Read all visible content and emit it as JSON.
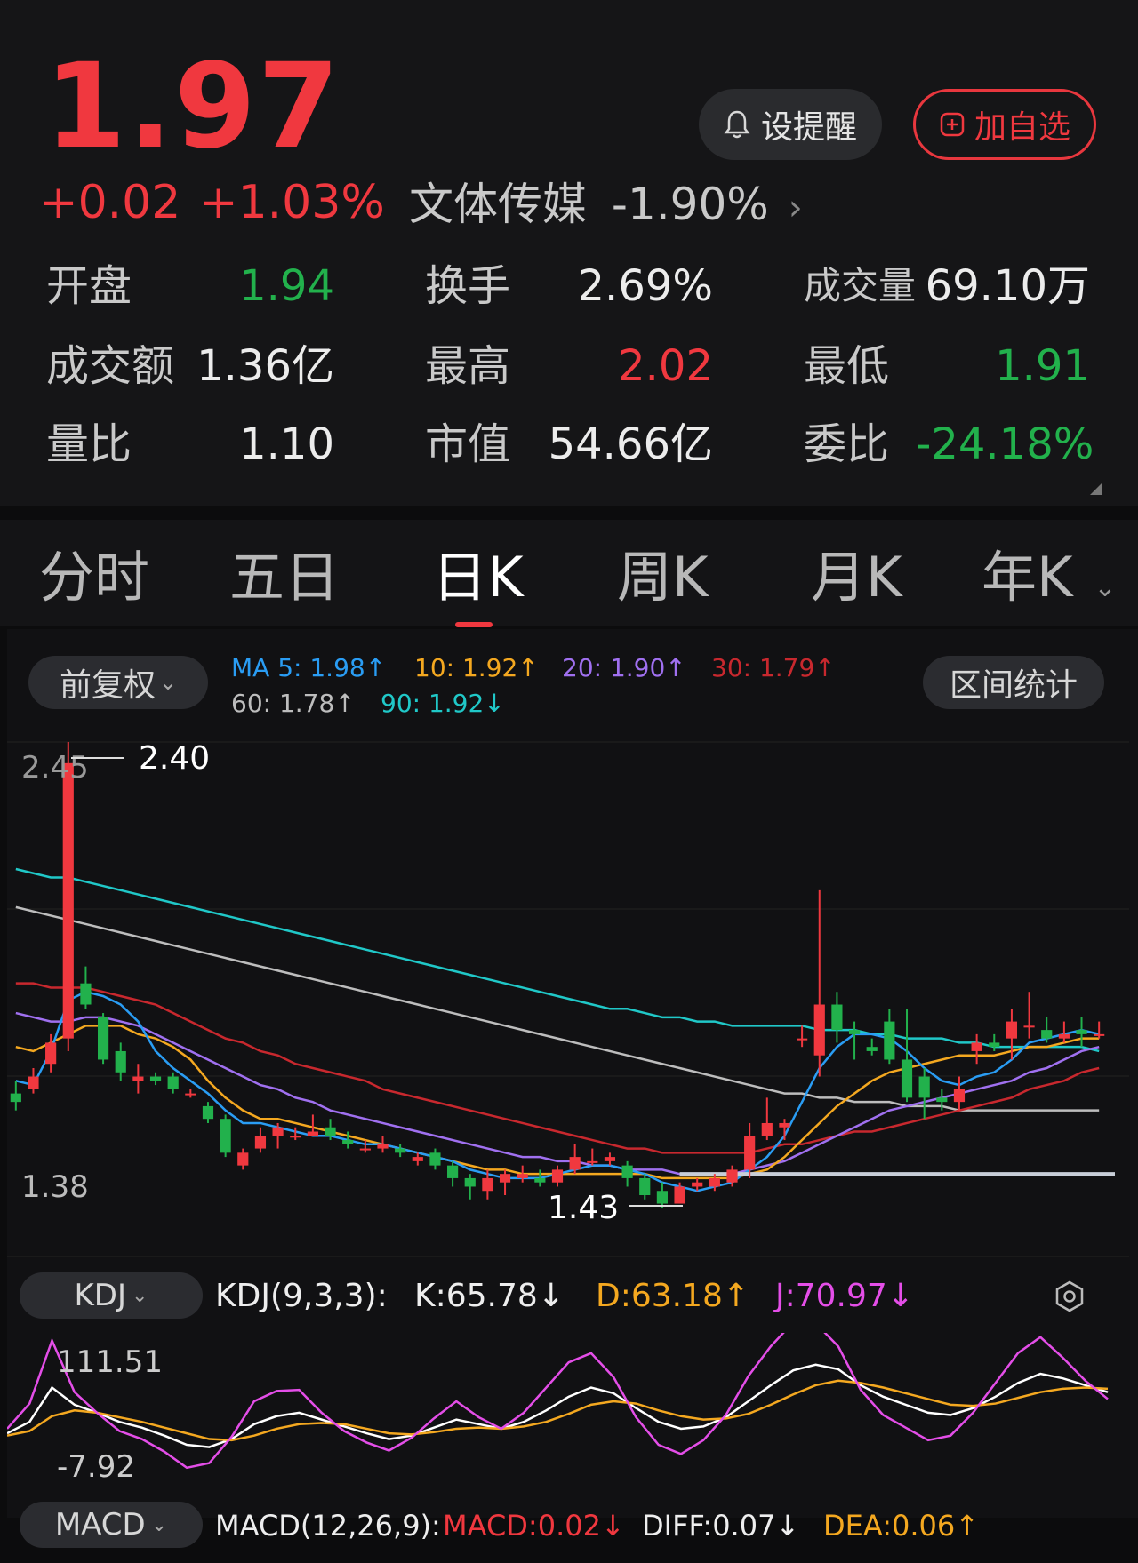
{
  "quote": {
    "price": "1.97",
    "change": "+0.02",
    "change_pct": "+1.03%",
    "sector_name": "文体传媒",
    "sector_change": "-1.90%",
    "sector_arrow": "›"
  },
  "actions": {
    "alert_label": "设提醒",
    "watch_label": "加自选"
  },
  "stats": {
    "open_label": "开盘",
    "open_value": "1.94",
    "turnover_label": "换手",
    "turnover_value": "2.69%",
    "volume_label": "成交量",
    "volume_value": "69.10万",
    "amount_label": "成交额",
    "amount_value": "1.36亿",
    "high_label": "最高",
    "high_value": "2.02",
    "low_label": "最低",
    "low_value": "1.91",
    "vol_ratio_label": "量比",
    "vol_ratio_value": "1.10",
    "mktcap_label": "市值",
    "mktcap_value": "54.66亿",
    "order_ratio_label": "委比",
    "order_ratio_value": "-24.18%"
  },
  "tabs": [
    "分时",
    "五日",
    "日K",
    "周K",
    "月K",
    "年K"
  ],
  "active_tab": "日K",
  "chart_controls": {
    "adjust_label": "前复权",
    "range_stats_label": "区间统计"
  },
  "ma_legend": {
    "ma5": "MA 5: 1.98↑",
    "ma10": "10: 1.92↑",
    "ma20": "20: 1.90↑",
    "ma30": "30: 1.79↑",
    "ma60": "60: 1.78↑",
    "ma90": "90: 1.92↓"
  },
  "colors": {
    "up": "#f0383f",
    "down": "#22b14c",
    "ma5": "#2a9df4",
    "ma10": "#f4a820",
    "ma20": "#a070f0",
    "ma30": "#c8282e",
    "ma60": "#bdbdbd",
    "ma90": "#20c8c8"
  },
  "kline_labels": {
    "axis_top": "2.45",
    "axis_bottom": "1.38",
    "marker_high": "2.40",
    "marker_low": "1.43"
  },
  "kdj": {
    "selector": "KDJ",
    "params": "KDJ(9,3,3):",
    "k": "K:65.78↓",
    "d": "D:63.18↑",
    "j": "J:70.97↓",
    "axis_top": "111.51",
    "axis_bottom": "-7.92"
  },
  "macd": {
    "selector": "MACD",
    "params": "MACD(12,26,9):",
    "macd": "MACD:0.02↓",
    "diff": "DIFF:0.07↓",
    "dea": "DEA:0.06↑"
  },
  "chart_data": [
    {
      "type": "candlestick",
      "ylim": [
        1.38,
        2.45
      ],
      "candles": [
        {
          "o": 1.62,
          "c": 1.6,
          "h": 1.65,
          "l": 1.58
        },
        {
          "o": 1.63,
          "c": 1.66,
          "h": 1.68,
          "l": 1.62
        },
        {
          "o": 1.69,
          "c": 1.74,
          "h": 1.76,
          "l": 1.67
        },
        {
          "o": 1.75,
          "c": 2.4,
          "h": 2.45,
          "l": 1.72
        },
        {
          "o": 1.88,
          "c": 1.83,
          "h": 1.92,
          "l": 1.82
        },
        {
          "o": 1.8,
          "c": 1.7,
          "h": 1.81,
          "l": 1.69
        },
        {
          "o": 1.72,
          "c": 1.67,
          "h": 1.74,
          "l": 1.65
        },
        {
          "o": 1.65,
          "c": 1.66,
          "h": 1.69,
          "l": 1.62
        },
        {
          "o": 1.66,
          "c": 1.65,
          "h": 1.67,
          "l": 1.64
        },
        {
          "o": 1.66,
          "c": 1.63,
          "h": 1.67,
          "l": 1.62
        },
        {
          "o": 1.62,
          "c": 1.62,
          "h": 1.63,
          "l": 1.61
        },
        {
          "o": 1.59,
          "c": 1.56,
          "h": 1.6,
          "l": 1.55
        },
        {
          "o": 1.56,
          "c": 1.48,
          "h": 1.57,
          "l": 1.47
        },
        {
          "o": 1.45,
          "c": 1.48,
          "h": 1.49,
          "l": 1.44
        },
        {
          "o": 1.49,
          "c": 1.52,
          "h": 1.54,
          "l": 1.48
        },
        {
          "o": 1.52,
          "c": 1.54,
          "h": 1.55,
          "l": 1.49
        },
        {
          "o": 1.52,
          "c": 1.52,
          "h": 1.54,
          "l": 1.51
        },
        {
          "o": 1.52,
          "c": 1.53,
          "h": 1.57,
          "l": 1.52
        },
        {
          "o": 1.54,
          "c": 1.52,
          "h": 1.56,
          "l": 1.51
        },
        {
          "o": 1.51,
          "c": 1.5,
          "h": 1.53,
          "l": 1.49
        },
        {
          "o": 1.49,
          "c": 1.49,
          "h": 1.51,
          "l": 1.48
        },
        {
          "o": 1.49,
          "c": 1.5,
          "h": 1.52,
          "l": 1.48
        },
        {
          "o": 1.49,
          "c": 1.48,
          "h": 1.5,
          "l": 1.47
        },
        {
          "o": 1.46,
          "c": 1.47,
          "h": 1.48,
          "l": 1.45
        },
        {
          "o": 1.48,
          "c": 1.45,
          "h": 1.49,
          "l": 1.44
        },
        {
          "o": 1.45,
          "c": 1.42,
          "h": 1.46,
          "l": 1.4
        },
        {
          "o": 1.42,
          "c": 1.4,
          "h": 1.43,
          "l": 1.37
        },
        {
          "o": 1.39,
          "c": 1.42,
          "h": 1.44,
          "l": 1.37
        },
        {
          "o": 1.41,
          "c": 1.43,
          "h": 1.44,
          "l": 1.38
        },
        {
          "o": 1.42,
          "c": 1.43,
          "h": 1.45,
          "l": 1.41
        },
        {
          "o": 1.42,
          "c": 1.41,
          "h": 1.44,
          "l": 1.4
        },
        {
          "o": 1.41,
          "c": 1.44,
          "h": 1.45,
          "l": 1.4
        },
        {
          "o": 1.44,
          "c": 1.47,
          "h": 1.5,
          "l": 1.43
        },
        {
          "o": 1.46,
          "c": 1.46,
          "h": 1.49,
          "l": 1.45
        },
        {
          "o": 1.46,
          "c": 1.47,
          "h": 1.48,
          "l": 1.45
        },
        {
          "o": 1.45,
          "c": 1.42,
          "h": 1.46,
          "l": 1.4
        },
        {
          "o": 1.42,
          "c": 1.38,
          "h": 1.43,
          "l": 1.37
        },
        {
          "o": 1.39,
          "c": 1.36,
          "h": 1.41,
          "l": 1.35
        },
        {
          "o": 1.36,
          "c": 1.4,
          "h": 1.41,
          "l": 1.36
        },
        {
          "o": 1.4,
          "c": 1.41,
          "h": 1.42,
          "l": 1.39
        },
        {
          "o": 1.4,
          "c": 1.42,
          "h": 1.43,
          "l": 1.39
        },
        {
          "o": 1.41,
          "c": 1.44,
          "h": 1.45,
          "l": 1.4
        },
        {
          "o": 1.44,
          "c": 1.52,
          "h": 1.55,
          "l": 1.42
        },
        {
          "o": 1.52,
          "c": 1.55,
          "h": 1.61,
          "l": 1.51
        },
        {
          "o": 1.54,
          "c": 1.55,
          "h": 1.56,
          "l": 1.51
        },
        {
          "o": 1.75,
          "c": 1.75,
          "h": 1.78,
          "l": 1.73
        },
        {
          "o": 1.71,
          "c": 1.83,
          "h": 2.1,
          "l": 1.66
        },
        {
          "o": 1.83,
          "c": 1.77,
          "h": 1.86,
          "l": 1.74
        },
        {
          "o": 1.77,
          "c": 1.76,
          "h": 1.79,
          "l": 1.7
        },
        {
          "o": 1.73,
          "c": 1.72,
          "h": 1.75,
          "l": 1.71
        },
        {
          "o": 1.79,
          "c": 1.7,
          "h": 1.82,
          "l": 1.69
        },
        {
          "o": 1.7,
          "c": 1.61,
          "h": 1.82,
          "l": 1.6
        },
        {
          "o": 1.66,
          "c": 1.61,
          "h": 1.68,
          "l": 1.56
        },
        {
          "o": 1.61,
          "c": 1.6,
          "h": 1.63,
          "l": 1.58
        },
        {
          "o": 1.6,
          "c": 1.63,
          "h": 1.66,
          "l": 1.58
        },
        {
          "o": 1.72,
          "c": 1.74,
          "h": 1.76,
          "l": 1.69
        },
        {
          "o": 1.74,
          "c": 1.73,
          "h": 1.76,
          "l": 1.72
        },
        {
          "o": 1.75,
          "c": 1.79,
          "h": 1.82,
          "l": 1.7
        },
        {
          "o": 1.78,
          "c": 1.78,
          "h": 1.86,
          "l": 1.75
        },
        {
          "o": 1.77,
          "c": 1.75,
          "h": 1.8,
          "l": 1.74
        },
        {
          "o": 1.75,
          "c": 1.76,
          "h": 1.79,
          "l": 1.74
        },
        {
          "o": 1.77,
          "c": 1.76,
          "h": 1.8,
          "l": 1.73
        },
        {
          "o": 1.76,
          "c": 1.76,
          "h": 1.79,
          "l": 1.75
        }
      ],
      "lines": {
        "ma5": [
          1.65,
          1.64,
          1.72,
          1.84,
          1.86,
          1.85,
          1.83,
          1.79,
          1.72,
          1.68,
          1.65,
          1.62,
          1.58,
          1.55,
          1.55,
          1.54,
          1.53,
          1.52,
          1.52,
          1.51,
          1.5,
          1.5,
          1.49,
          1.48,
          1.47,
          1.46,
          1.44,
          1.43,
          1.42,
          1.42,
          1.42,
          1.43,
          1.44,
          1.45,
          1.45,
          1.44,
          1.43,
          1.41,
          1.4,
          1.39,
          1.4,
          1.41,
          1.44,
          1.47,
          1.52,
          1.6,
          1.68,
          1.73,
          1.76,
          1.76,
          1.75,
          1.72,
          1.68,
          1.65,
          1.64,
          1.66,
          1.67,
          1.7,
          1.74,
          1.75,
          1.76,
          1.77,
          1.76
        ],
        "ma10": [
          1.73,
          1.72,
          1.74,
          1.76,
          1.78,
          1.78,
          1.78,
          1.76,
          1.75,
          1.73,
          1.7,
          1.65,
          1.61,
          1.58,
          1.56,
          1.56,
          1.55,
          1.54,
          1.53,
          1.52,
          1.51,
          1.5,
          1.49,
          1.48,
          1.47,
          1.46,
          1.45,
          1.44,
          1.44,
          1.43,
          1.43,
          1.43,
          1.43,
          1.43,
          1.43,
          1.43,
          1.43,
          1.42,
          1.42,
          1.42,
          1.42,
          1.42,
          1.43,
          1.44,
          1.47,
          1.51,
          1.55,
          1.59,
          1.62,
          1.65,
          1.67,
          1.68,
          1.69,
          1.7,
          1.71,
          1.71,
          1.71,
          1.72,
          1.73,
          1.73,
          1.74,
          1.75,
          1.75
        ],
        "ma20": [
          1.81,
          1.8,
          1.79,
          1.79,
          1.8,
          1.8,
          1.79,
          1.78,
          1.76,
          1.74,
          1.72,
          1.7,
          1.68,
          1.66,
          1.64,
          1.63,
          1.61,
          1.6,
          1.58,
          1.57,
          1.56,
          1.55,
          1.54,
          1.53,
          1.52,
          1.51,
          1.5,
          1.49,
          1.48,
          1.47,
          1.47,
          1.46,
          1.46,
          1.45,
          1.45,
          1.44,
          1.44,
          1.44,
          1.43,
          1.43,
          1.43,
          1.43,
          1.44,
          1.45,
          1.46,
          1.48,
          1.5,
          1.52,
          1.54,
          1.56,
          1.58,
          1.59,
          1.6,
          1.61,
          1.62,
          1.63,
          1.64,
          1.65,
          1.67,
          1.68,
          1.7,
          1.72,
          1.73
        ],
        "ma30": [
          1.88,
          1.88,
          1.87,
          1.87,
          1.87,
          1.86,
          1.85,
          1.84,
          1.83,
          1.81,
          1.79,
          1.77,
          1.75,
          1.74,
          1.72,
          1.71,
          1.69,
          1.68,
          1.67,
          1.66,
          1.65,
          1.63,
          1.62,
          1.61,
          1.6,
          1.59,
          1.58,
          1.57,
          1.56,
          1.55,
          1.54,
          1.53,
          1.52,
          1.51,
          1.5,
          1.49,
          1.49,
          1.48,
          1.48,
          1.48,
          1.48,
          1.48,
          1.48,
          1.49,
          1.5,
          1.5,
          1.51,
          1.52,
          1.53,
          1.53,
          1.54,
          1.55,
          1.56,
          1.57,
          1.58,
          1.59,
          1.6,
          1.61,
          1.63,
          1.64,
          1.65,
          1.67,
          1.68
        ],
        "ma60": [
          2.06,
          2.05,
          2.04,
          2.03,
          2.02,
          2.01,
          2.0,
          1.99,
          1.98,
          1.97,
          1.96,
          1.95,
          1.94,
          1.93,
          1.92,
          1.91,
          1.9,
          1.89,
          1.88,
          1.87,
          1.86,
          1.85,
          1.84,
          1.83,
          1.82,
          1.81,
          1.8,
          1.79,
          1.78,
          1.77,
          1.76,
          1.75,
          1.74,
          1.73,
          1.72,
          1.71,
          1.7,
          1.69,
          1.68,
          1.67,
          1.66,
          1.65,
          1.64,
          1.63,
          1.62,
          1.62,
          1.61,
          1.61,
          1.6,
          1.6,
          1.6,
          1.59,
          1.59,
          1.59,
          1.58,
          1.58,
          1.58,
          1.58,
          1.58,
          1.58,
          1.58,
          1.58,
          1.58
        ],
        "ma90": [
          2.15,
          2.14,
          2.13,
          2.13,
          2.12,
          2.11,
          2.1,
          2.09,
          2.08,
          2.07,
          2.06,
          2.05,
          2.04,
          2.03,
          2.02,
          2.01,
          2.0,
          1.99,
          1.98,
          1.97,
          1.96,
          1.95,
          1.94,
          1.93,
          1.92,
          1.91,
          1.9,
          1.89,
          1.88,
          1.87,
          1.86,
          1.85,
          1.84,
          1.83,
          1.82,
          1.82,
          1.81,
          1.8,
          1.8,
          1.79,
          1.79,
          1.78,
          1.78,
          1.78,
          1.78,
          1.78,
          1.77,
          1.77,
          1.77,
          1.76,
          1.76,
          1.75,
          1.75,
          1.75,
          1.74,
          1.74,
          1.73,
          1.73,
          1.73,
          1.73,
          1.73,
          1.73,
          1.72
        ]
      },
      "support_line": 1.43
    },
    {
      "type": "line",
      "ylim": [
        -7.92,
        111.51
      ],
      "series": [
        {
          "name": "K",
          "values": [
            30,
            40,
            70,
            55,
            48,
            40,
            35,
            28,
            20,
            18,
            25,
            38,
            45,
            48,
            42,
            36,
            30,
            25,
            28,
            35,
            42,
            38,
            34,
            40,
            50,
            62,
            70,
            65,
            52,
            40,
            34,
            36,
            44,
            58,
            72,
            85,
            90,
            86,
            72,
            62,
            55,
            48,
            46,
            52,
            62,
            74,
            82,
            78,
            72,
            66
          ]
        },
        {
          "name": "D",
          "values": [
            28,
            32,
            45,
            50,
            48,
            44,
            40,
            35,
            30,
            25,
            24,
            28,
            34,
            38,
            39,
            38,
            34,
            30,
            29,
            31,
            34,
            35,
            34,
            36,
            40,
            47,
            55,
            58,
            56,
            50,
            45,
            42,
            43,
            47,
            55,
            64,
            72,
            76,
            74,
            70,
            65,
            60,
            55,
            54,
            56,
            61,
            66,
            69,
            70,
            69
          ]
        },
        {
          "name": "J",
          "values": [
            34,
            56,
            111,
            66,
            48,
            32,
            25,
            14,
            0,
            4,
            27,
            58,
            67,
            68,
            48,
            32,
            22,
            15,
            26,
            43,
            58,
            44,
            34,
            48,
            70,
            92,
            100,
            79,
            44,
            20,
            12,
            24,
            46,
            80,
            106,
            127,
            126,
            106,
            68,
            46,
            35,
            24,
            28,
            48,
            74,
            100,
            114,
            96,
            76,
            60
          ]
        }
      ]
    }
  ]
}
